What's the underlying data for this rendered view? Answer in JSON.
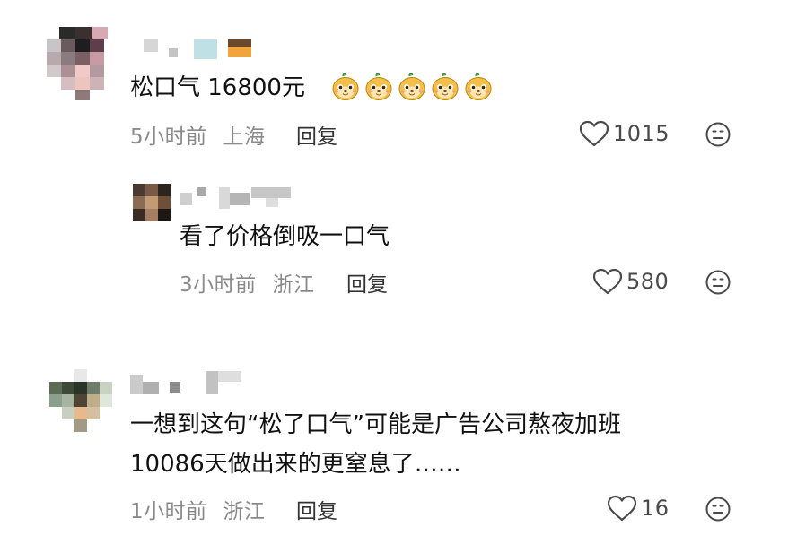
{
  "comments": [
    {
      "text": "松口气 16800元",
      "emoji_icon": "shiba-dog-emoji",
      "emoji_count": 5,
      "time": "5小时前",
      "location": "上海",
      "reply_label": "回复",
      "likes": "1015"
    },
    {
      "text": "看了价格倒吸一口气",
      "time": "3小时前",
      "location": "浙江",
      "reply_label": "回复",
      "likes": "580"
    },
    {
      "text_line1": "一想到这句“松了口气”可能是广告公司熬夜加班",
      "text_line2": "10086天做出来的更窒息了……",
      "time": "1小时前",
      "location": "浙江",
      "reply_label": "回复",
      "likes": "16"
    }
  ],
  "icons": {
    "like": "heart-outline-icon",
    "dislike": "frown-face-icon"
  }
}
